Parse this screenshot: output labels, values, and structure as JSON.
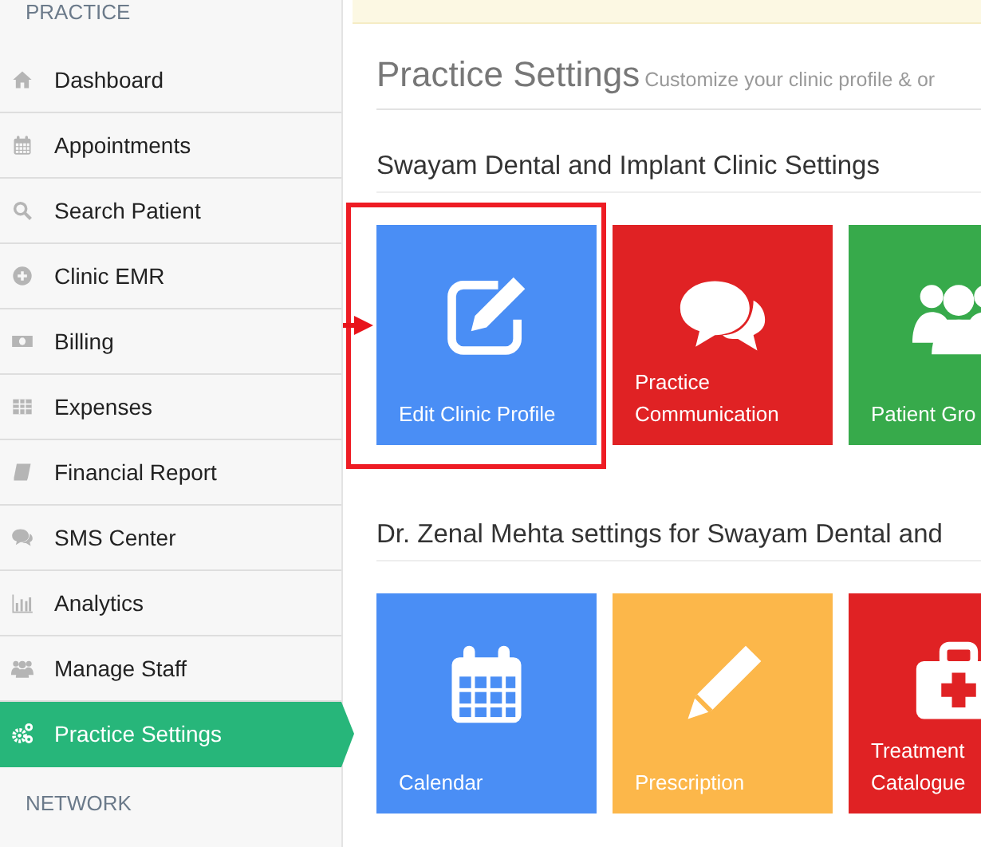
{
  "sidebar": {
    "heading": "PRACTICE",
    "items": [
      {
        "label": "Dashboard",
        "kind": "home",
        "selected": false
      },
      {
        "label": "Appointments",
        "kind": "calendar",
        "selected": false
      },
      {
        "label": "Search Patient",
        "kind": "search",
        "selected": false
      },
      {
        "label": "Clinic EMR",
        "kind": "plus",
        "selected": false
      },
      {
        "label": "Billing",
        "kind": "money",
        "selected": false
      },
      {
        "label": "Expenses",
        "kind": "table",
        "selected": false
      },
      {
        "label": "Financial Report",
        "kind": "book",
        "selected": false
      },
      {
        "label": "SMS Center",
        "kind": "chat",
        "selected": false
      },
      {
        "label": "Analytics",
        "kind": "bars",
        "selected": false
      },
      {
        "label": "Manage Staff",
        "kind": "users",
        "selected": false
      },
      {
        "label": "Practice Settings",
        "kind": "gears",
        "selected": true
      }
    ],
    "footer_heading": "NETWORK"
  },
  "page": {
    "title": "Practice Settings",
    "subtitle": "Customize your clinic profile & or"
  },
  "sections": [
    {
      "title": "Swayam Dental and Implant Clinic Settings",
      "tiles": [
        {
          "label": "Edit Clinic Profile",
          "kind": "edit",
          "color": "#4a8ef5",
          "highlighted": true
        },
        {
          "label": "Practice Communication",
          "kind": "chat",
          "color": "#e02224",
          "highlighted": false
        },
        {
          "label": "Patient Gro",
          "kind": "users",
          "color": "#37aa4b",
          "highlighted": false
        }
      ]
    },
    {
      "title": "Dr. Zenal Mehta settings for Swayam Dental and",
      "tiles": [
        {
          "label": "Calendar",
          "kind": "calendar",
          "color": "#4a8ef5",
          "highlighted": false
        },
        {
          "label": "Prescription",
          "kind": "pencil",
          "color": "#fcb74a",
          "highlighted": false
        },
        {
          "label": "Treatment Catalogue",
          "kind": "medkit",
          "color": "#e02224",
          "highlighted": false
        }
      ]
    }
  ]
}
